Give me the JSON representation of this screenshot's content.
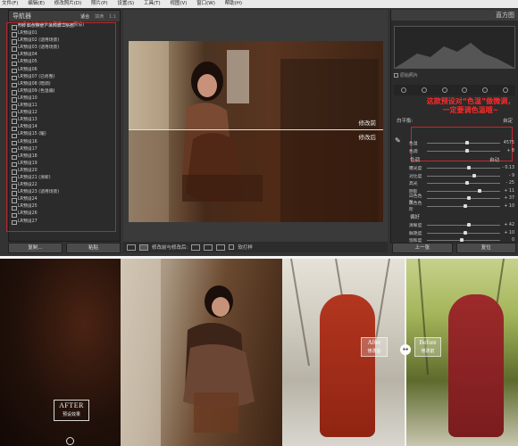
{
  "menubar": [
    "文件(F)",
    "编辑(E)",
    "修改照片(D)",
    "照片(P)",
    "设置(S)",
    "工具(T)",
    "视图(V)",
    "窗口(W)",
    "帮助(H)"
  ],
  "left_panel": {
    "title": "导航器",
    "tabs": [
      "适合",
      "填满",
      "1:1"
    ],
    "folder": "▾ 适合人像中世文照场台(LR预设)",
    "presets": [
      "(附) 如想快捷，请阅第二张图",
      "LR预设01",
      "LR预设02 (适用场景)",
      "LR预设03 (适用场景)",
      "LR预设04",
      "LR预设05",
      "LR预设06",
      "LR预设07 (已修整)",
      "LR预设08 (暗调)",
      "LR预设09 (色温偏)",
      "LR预设10",
      "LR预设11",
      "LR预设12",
      "LR预设13",
      "LR预设14",
      "LR预设15 (暖)",
      "LR预设16",
      "LR预设17",
      "LR预设18",
      "LR预设19",
      "LR预设20",
      "LR预设21 (清新)",
      "LR预设22",
      "LR预设23 (适用场景)",
      "LR预设24",
      "LR预设25",
      "LR预设26",
      "LR预设27"
    ],
    "copy_button": "复制...",
    "paste_button": "粘贴"
  },
  "center": {
    "label_before": "修改前",
    "label_after": "修改后",
    "toolbar_text": "修改前与修改后:",
    "softproof": "软打样"
  },
  "right_panel": {
    "title": "直方图",
    "original_photo": "原始照片",
    "note": "这款预设对“色温”做微调，一定要调色温哦~",
    "wb_label": "白平衡:",
    "wb_value": "自定",
    "temp": {
      "label": "色温",
      "value": "4575"
    },
    "tint": {
      "label": "色调",
      "value": "+ 8"
    },
    "tone_head": "色调",
    "tone_auto": "自动",
    "tone_sliders": [
      {
        "label": "曝光度",
        "value": "- 0.13"
      },
      {
        "label": "对比度",
        "value": "- 9"
      },
      {
        "label": "高光",
        "value": "- 25"
      },
      {
        "label": "阴影",
        "value": "+ 11"
      },
      {
        "label": "白色色阶",
        "value": "+ 37"
      },
      {
        "label": "黑色色阶",
        "value": "+ 10"
      }
    ],
    "presence_head": "偏好",
    "presence_sliders": [
      {
        "label": "清晰度",
        "value": "+ 42"
      },
      {
        "label": "鲜艳度",
        "value": "+ 10"
      },
      {
        "label": "饱和度",
        "value": "0"
      }
    ],
    "prev_button": "上一张",
    "reset_button": "复位"
  },
  "bottom": {
    "after_title": "AFTER",
    "after_sub": "预设效果",
    "tag_after": {
      "t1": "After",
      "t2": "修改后"
    },
    "tag_before": {
      "t1": "Before",
      "t2": "修改前"
    }
  }
}
